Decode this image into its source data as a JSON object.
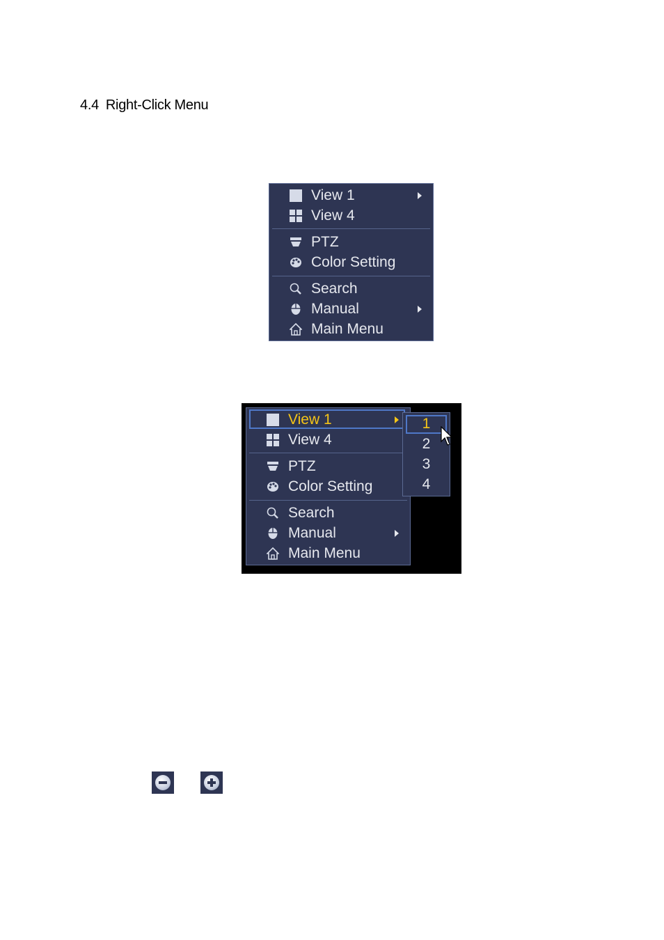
{
  "section": {
    "number": "4.4",
    "title": "Right-Click Menu"
  },
  "menu": {
    "items": [
      {
        "label": "View 1",
        "icon": "single-view-icon",
        "has_submenu": true
      },
      {
        "label": "View 4",
        "icon": "quad-view-icon",
        "has_submenu": false
      },
      {
        "label": "PTZ",
        "icon": "dome-camera-icon",
        "has_submenu": false
      },
      {
        "label": "Color Setting",
        "icon": "palette-icon",
        "has_submenu": false
      },
      {
        "label": "Search",
        "icon": "search-icon",
        "has_submenu": false
      },
      {
        "label": "Manual",
        "icon": "mouse-icon",
        "has_submenu": true
      },
      {
        "label": "Main Menu",
        "icon": "home-icon",
        "has_submenu": false
      }
    ]
  },
  "expanded_menu": {
    "highlighted_item": "View 1",
    "highlight_color": "#f5c518",
    "submenu": [
      "1",
      "2",
      "3",
      "4"
    ],
    "submenu_selected": "1"
  },
  "zoom_buttons": [
    {
      "name": "zoom-out",
      "icon": "minus-circle-icon"
    },
    {
      "name": "zoom-in",
      "icon": "plus-circle-icon"
    }
  ],
  "colors": {
    "menu_bg": "#2e3553",
    "menu_border": "#5b6a93",
    "highlight_border": "#4f78c8",
    "text": "#e6e8ee"
  }
}
